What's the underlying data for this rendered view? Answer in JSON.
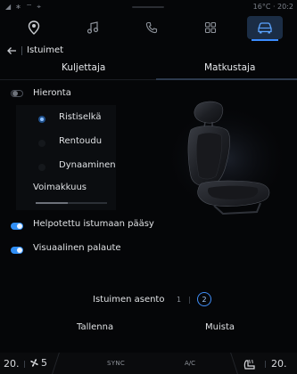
{
  "status": {
    "left_icons": [
      "signal-icon",
      "bluetooth-icon",
      "wifi-icon",
      "location-icon"
    ],
    "right": "16°C · 20:2"
  },
  "nav": {
    "items": [
      {
        "name": "navigation-icon",
        "glyph": "⌾"
      },
      {
        "name": "music-icon",
        "glyph": "♫"
      },
      {
        "name": "phone-icon",
        "glyph": "✆"
      },
      {
        "name": "apps-icon",
        "glyph": "▦"
      },
      {
        "name": "car-icon",
        "glyph": "⛟"
      }
    ],
    "active_index": 4
  },
  "header": {
    "title": "Istuimet"
  },
  "tabs": {
    "left": "Kuljettaja",
    "right": "Matkustaja",
    "active": "right"
  },
  "massage": {
    "label": "Hieronta",
    "enabled": false,
    "options": [
      "Ristiselkä",
      "Rentoudu",
      "Dynaaminen"
    ],
    "selected_index": 0,
    "intensity_label": "Voimakkuus",
    "intensity_value": 0.45
  },
  "easy_access": {
    "label": "Helpotettu istumaan pääsy",
    "enabled": true
  },
  "visual_feedback": {
    "label": "Visuaalinen palaute",
    "enabled": true
  },
  "seat_position": {
    "label": "Istuimen asento",
    "positions": [
      "1",
      "2"
    ],
    "selected": "2"
  },
  "actions": {
    "save": "Tallenna",
    "recall": "Muista"
  },
  "climate": {
    "temp_left": "20.",
    "fan_level": "5",
    "sync": "SYNC",
    "ac": "A/C",
    "temp_right": "20."
  },
  "colors": {
    "accent": "#2f8ef5",
    "background": "#050608"
  }
}
